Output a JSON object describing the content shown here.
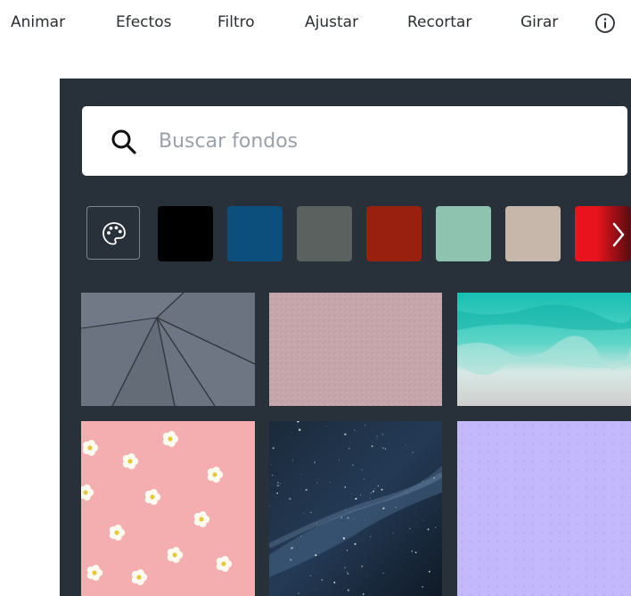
{
  "toolbar": {
    "items": [
      "Animar",
      "Efectos",
      "Filtro",
      "Ajustar",
      "Recortar",
      "Girar"
    ],
    "info_icon": "info-circle-icon"
  },
  "search": {
    "placeholder": "Buscar fondos",
    "icon": "search-icon"
  },
  "colors": {
    "palette_icon": "palette-icon",
    "swatches": [
      "#000000",
      "#0d4f7c",
      "#5b615e",
      "#99200e",
      "#8ec3b0",
      "#c7b6aa",
      "#e8131c"
    ],
    "more_icon": "chevron-right-icon"
  },
  "backgrounds": {
    "items": [
      "gray-geometric-background",
      "pink-textured-background",
      "teal-watercolor-background",
      "pink-flowers-background",
      "starry-sky-background",
      "lavender-pattern-background"
    ]
  }
}
